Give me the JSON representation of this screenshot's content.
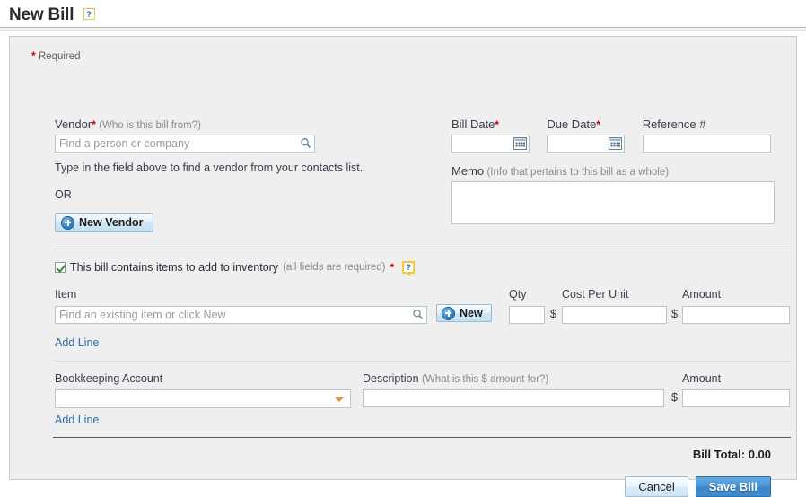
{
  "header": {
    "title": "New Bill",
    "help_label": "?"
  },
  "form": {
    "required_star": "*",
    "required_note": "Required",
    "vendor": {
      "label": "Vendor",
      "star": "*",
      "hint": "(Who is this bill from?)",
      "placeholder": "Find a person or company",
      "value": "",
      "search_icon": "search-icon",
      "note": "Type in the field above to find a vendor from your contacts list.",
      "or": "OR",
      "new_vendor_button": "New Vendor"
    },
    "bill_date": {
      "label": "Bill Date",
      "star": "*",
      "value": "",
      "calendar_icon": "calendar-icon"
    },
    "due_date": {
      "label": "Due Date",
      "star": "*",
      "value": "",
      "calendar_icon": "calendar-icon"
    },
    "reference": {
      "label": "Reference #",
      "value": ""
    },
    "memo": {
      "label": "Memo",
      "hint": "(Info that pertains to this bill as a whole)",
      "value": ""
    },
    "inventory": {
      "checked": true,
      "label": "This bill contains items to add to inventory",
      "hint": "(all fields are required)",
      "star": "*",
      "tip_label": "?",
      "item": {
        "label": "Item",
        "placeholder": "Find an existing item or click New",
        "value": "",
        "search_icon": "search-icon",
        "new_button": "New"
      },
      "qty": {
        "label": "Qty",
        "value": ""
      },
      "cost_per_unit": {
        "label": "Cost Per Unit",
        "currency": "$",
        "value": ""
      },
      "amount": {
        "label": "Amount",
        "currency": "$",
        "value": ""
      },
      "add_line": "Add Line"
    },
    "bookkeeping": {
      "account": {
        "label": "Bookkeeping Account",
        "selected": ""
      },
      "description": {
        "label": "Description",
        "hint": "(What is this $ amount for?)",
        "value": ""
      },
      "amount": {
        "label": "Amount",
        "currency": "$",
        "value": ""
      },
      "add_line": "Add Line"
    }
  },
  "footer": {
    "bill_total": "Bill Total: 0.00",
    "cancel_label": "Cancel",
    "save_label": "Save Bill"
  },
  "colors": {
    "panel_bg": "#efefef",
    "panel_border": "#c9c9c9",
    "input_border": "#b6c8c2",
    "link": "#2d6ca8",
    "required": "#cc0000",
    "tip_border": "#f2cb3a",
    "save_button": "#4a96d6",
    "select_arrow": "#e09a3a",
    "check_mark": "#3a8a2f"
  }
}
